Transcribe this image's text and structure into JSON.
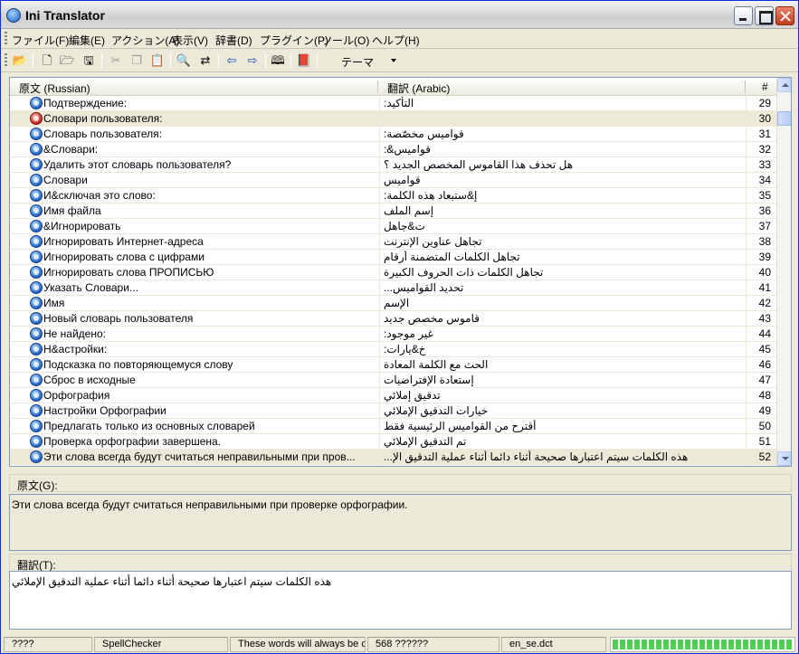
{
  "window": {
    "title": "Ini Translator"
  },
  "menu": [
    "ファイル(F)",
    "編集(E)",
    "アクション(A)",
    "表示(V)",
    "辞書(D)",
    "プラグイン(P)",
    "ツール(O)",
    "ヘルプ(H)"
  ],
  "toolbar": {
    "icons": [
      "open-folder-icon",
      "new-document-icon",
      "open-icon",
      "save-icon",
      "cut-icon",
      "copy-icon",
      "paste-icon",
      "find-icon",
      "replace-icon",
      "previous-icon",
      "next-icon",
      "dictionary-icon",
      "book-icon"
    ],
    "theme_label": "テーマ"
  },
  "list": {
    "headers": {
      "source": "原文 (Russian)",
      "translation": "翻訳 (Arabic)",
      "number": "#"
    },
    "rows": [
      {
        "src": "Подтверждение:",
        "tr": "التأكيد:",
        "num": "29",
        "icon": "globe-icon"
      },
      {
        "src": "Словари пользователя:",
        "tr": "",
        "num": "30",
        "icon": "alert-icon"
      },
      {
        "src": "Словарь пользователя:",
        "tr": "قواميس مخصّصة:",
        "num": "31",
        "icon": "globe-icon"
      },
      {
        "src": "&Словари:",
        "tr": "قواميس&:",
        "num": "32",
        "icon": "globe-icon"
      },
      {
        "src": "Удалить этот словарь пользователя?",
        "tr": "هل تحذف هذا القاموس المخصص الجديد ؟",
        "num": "33",
        "icon": "globe-icon"
      },
      {
        "src": "Словари",
        "tr": "قواميس",
        "num": "34",
        "icon": "globe-icon"
      },
      {
        "src": "И&сключая это слово:",
        "tr": "إ&ستبعاد هذه الكلمة:",
        "num": "35",
        "icon": "globe-icon"
      },
      {
        "src": "Имя файла",
        "tr": "إسم الملف",
        "num": "36",
        "icon": "globe-icon"
      },
      {
        "src": "&Игнорировать",
        "tr": "ت&جاهل",
        "num": "37",
        "icon": "globe-icon"
      },
      {
        "src": "Игнорировать Интернет-адреса",
        "tr": "تجاهل عناوين الإنترنت",
        "num": "38",
        "icon": "globe-icon"
      },
      {
        "src": "Игнорировать слова с цифрами",
        "tr": "تجاهل الكلمات المتضمنة أرقام",
        "num": "39",
        "icon": "globe-icon"
      },
      {
        "src": "Игнорировать слова ПРОПИСЬЮ",
        "tr": "تجاهل الكلمات ذات الحروف الكبيرة",
        "num": "40",
        "icon": "globe-icon"
      },
      {
        "src": "Указать Словари...",
        "tr": "تحديد القواميس...",
        "num": "41",
        "icon": "globe-icon"
      },
      {
        "src": "Имя",
        "tr": "الإسم",
        "num": "42",
        "icon": "globe-icon"
      },
      {
        "src": "Новый словарь пользователя",
        "tr": "قاموس مخصص جديد",
        "num": "43",
        "icon": "globe-icon"
      },
      {
        "src": "Не найдено:",
        "tr": "غير موجود:",
        "num": "44",
        "icon": "globe-icon"
      },
      {
        "src": "Н&астройки:",
        "tr": "خ&يارات:",
        "num": "45",
        "icon": "globe-icon"
      },
      {
        "src": "Подсказка по повторяющемуся слову",
        "tr": "الحث مع الكلمة المعادة",
        "num": "46",
        "icon": "globe-icon"
      },
      {
        "src": "Сброс в исходные",
        "tr": "إستعادة الإفتراضيات",
        "num": "47",
        "icon": "globe-icon"
      },
      {
        "src": "Орфография",
        "tr": "تدقيق إملائي",
        "num": "48",
        "icon": "globe-icon"
      },
      {
        "src": "Настройки Орфографии",
        "tr": "خيارات التدقيق الإملائي",
        "num": "49",
        "icon": "globe-icon"
      },
      {
        "src": "Предлагать только из основных словарей",
        "tr": "أقترح من القواميس الرئيسية فقط",
        "num": "50",
        "icon": "globe-icon"
      },
      {
        "src": "Проверка орфографии завершена.",
        "tr": "تم التدقيق الإملائي",
        "num": "51",
        "icon": "globe-icon"
      },
      {
        "src": "Эти слова всегда будут считаться неправильными при пров...",
        "tr": "هذه الكلمات سيتم اعتبارها صحيحة أثناء دائما أثناء عملية التدقيق الإ...",
        "num": "52",
        "icon": "globe-icon"
      }
    ]
  },
  "source_pane": {
    "label": "原文(G):",
    "text": "Эти слова всегда будут считаться неправильными при проверке орфографии."
  },
  "translation_pane": {
    "label": "翻訳(T):",
    "text": "هذه الكلمات سيتم اعتبارها صحيحة أثناء دائما أثناء عملية التدقيق الإملائي"
  },
  "statusbar": {
    "cells": [
      "????",
      "SpellChecker",
      "These words will always be considered",
      "568 ??????",
      "en_se.dct"
    ],
    "progress": 1.0
  }
}
